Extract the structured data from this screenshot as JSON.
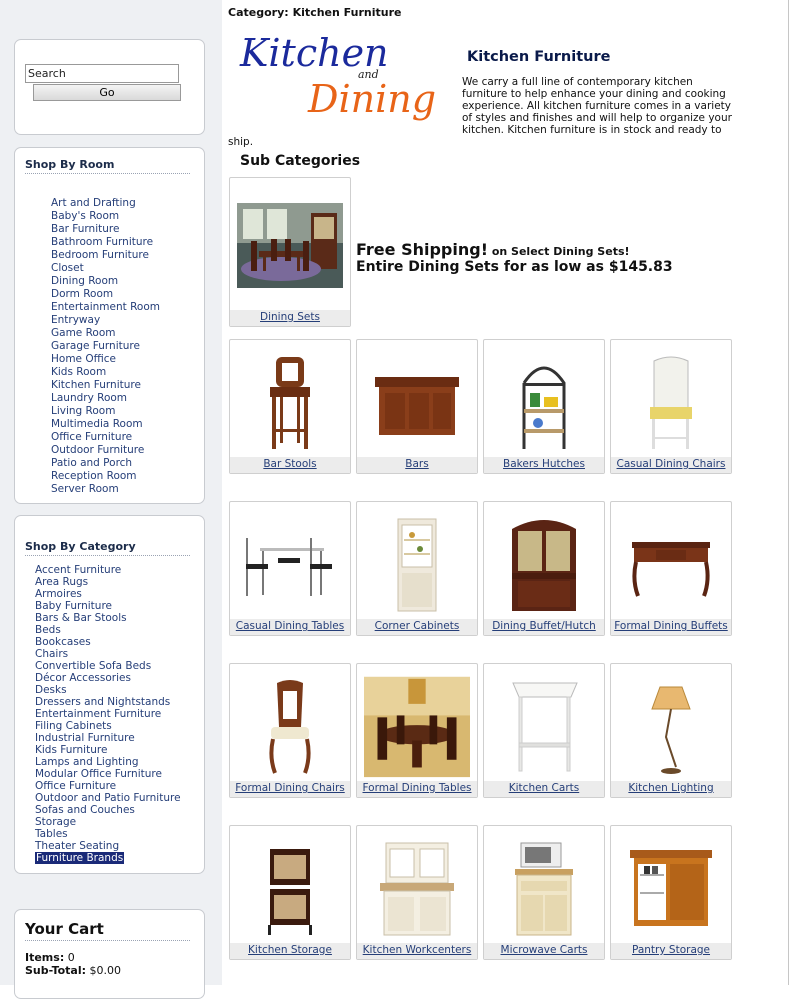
{
  "search": {
    "value": "Search",
    "button_label": "Go"
  },
  "rooms": {
    "title": "Shop By Room",
    "items": [
      "Art and Drafting",
      "Baby's Room",
      "Bar Furniture",
      "Bathroom Furniture",
      "Bedroom Furniture",
      "Closet",
      "Dining Room",
      "Dorm Room",
      "Entertainment Room",
      "Entryway",
      "Game Room",
      "Garage Furniture",
      "Home Office",
      "Kids Room",
      "Kitchen Furniture",
      "Laundry Room",
      "Living Room",
      "Multimedia Room",
      "Office Furniture",
      "Outdoor Furniture",
      "Patio and Porch",
      "Reception Room",
      "Server Room"
    ]
  },
  "categories": {
    "title": "Shop By Category",
    "items": [
      "Accent Furniture",
      "Area Rugs",
      "Armoires",
      "Baby Furniture",
      "Bars & Bar Stools",
      "Beds",
      "Bookcases",
      "Chairs",
      "Convertible Sofa Beds",
      "Décor Accessories",
      "Desks",
      "Dressers and Nightstands",
      "Entertainment Furniture",
      "Filing Cabinets",
      "Industrial Furniture",
      "Kids Furniture",
      "Lamps and Lighting",
      "Modular Office Furniture",
      "Office Furniture",
      "Outdoor and Patio Furniture",
      "Sofas and Couches",
      "Storage",
      "Tables",
      "Theater Seating",
      "Furniture Brands"
    ],
    "selected": "Furniture Brands"
  },
  "cart": {
    "title": "Your Cart",
    "items_label": "Items:",
    "items_value": "0",
    "subtotal_label": "Sub-Total:",
    "subtotal_value": "$0.00"
  },
  "breadcrumb": {
    "label": "Category:",
    "value": "Kitchen Furniture"
  },
  "logo": {
    "word1": "Kitchen",
    "word2": "and",
    "word3": "Dining"
  },
  "header": {
    "title": "Kitchen Furniture",
    "description": "We carry a full line of contemporary kitchen furniture to help enhance your dining and cooking experience. All kitchen furniture comes in a variety of styles and finishes and will help to organize your kitchen. Kitchen furniture is in stock and ready to ship."
  },
  "subcategories_title": "Sub Categories",
  "promo": {
    "headline": "Free Shipping!",
    "headline_suffix": " on Select Dining Sets!",
    "line2": "Entire Dining Sets for as low as $145.83"
  },
  "featured": {
    "label": "Dining Sets"
  },
  "products": [
    {
      "label": "Bar Stools"
    },
    {
      "label": "Bars"
    },
    {
      "label": "Bakers Hutches"
    },
    {
      "label": "Casual Dining Chairs"
    },
    {
      "label": "Casual Dining Tables"
    },
    {
      "label": "Corner Cabinets"
    },
    {
      "label": "Dining Buffet/Hutch"
    },
    {
      "label": "Formal Dining Buffets"
    },
    {
      "label": "Formal Dining Chairs"
    },
    {
      "label": "Formal Dining Tables"
    },
    {
      "label": "Kitchen Carts"
    },
    {
      "label": "Kitchen Lighting"
    },
    {
      "label": "Kitchen Storage"
    },
    {
      "label": "Kitchen Workcenters"
    },
    {
      "label": "Microwave Carts"
    },
    {
      "label": "Pantry Storage"
    }
  ],
  "colors": {
    "link": "#253e78",
    "selected_bg": "#1a2a78",
    "title_navy": "#0a1a4a",
    "logo_blue": "#1b2a9c",
    "logo_orange": "#e86418"
  }
}
